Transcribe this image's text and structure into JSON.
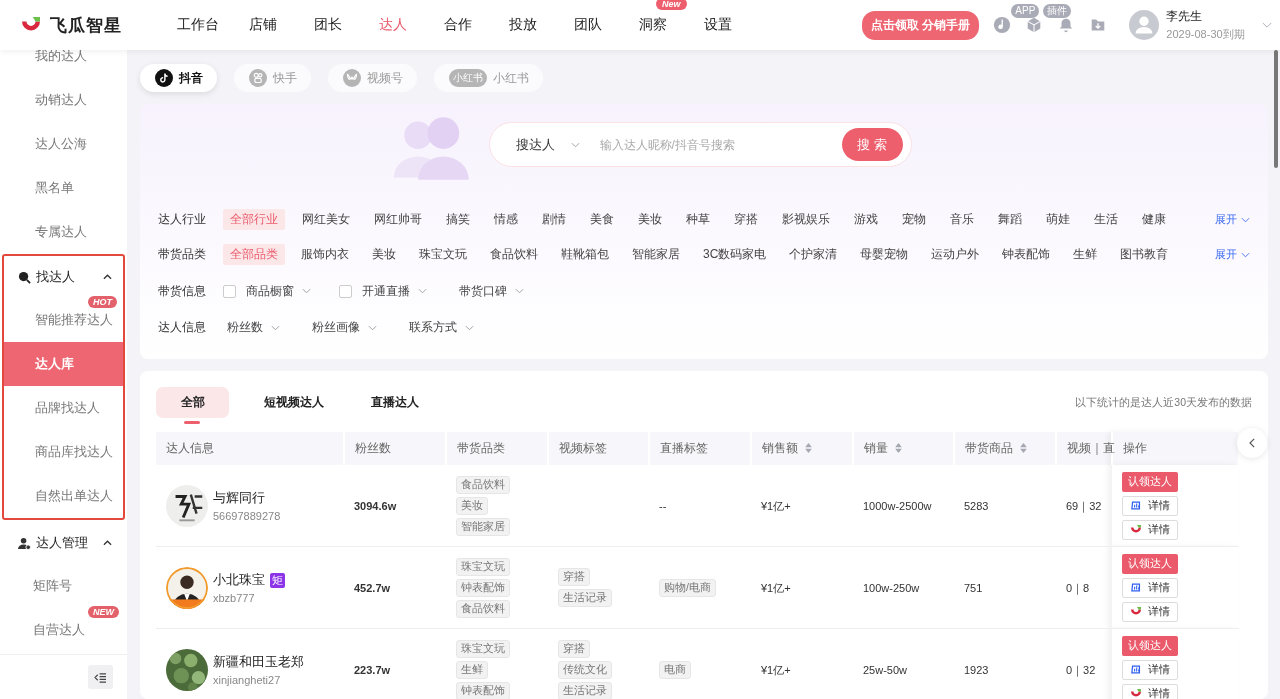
{
  "brand": {
    "name": "飞瓜智星"
  },
  "nav": [
    {
      "label": "工作台",
      "selected": false
    },
    {
      "label": "店铺",
      "selected": false
    },
    {
      "label": "团长",
      "selected": false
    },
    {
      "label": "达人",
      "selected": true
    },
    {
      "label": "合作",
      "selected": false
    },
    {
      "label": "投放",
      "selected": false
    },
    {
      "label": "团队",
      "selected": false
    },
    {
      "label": "洞察",
      "selected": false,
      "badge": "New"
    },
    {
      "label": "设置",
      "selected": false
    }
  ],
  "promo_button": "点击领取 分销手册",
  "header_badges": {
    "app": "APP",
    "plugin": "插件"
  },
  "user": {
    "name": "李先生",
    "expiry": "2029-08-30到期"
  },
  "sidebar": {
    "items": [
      {
        "label": "我的达人"
      },
      {
        "label": "动销达人"
      },
      {
        "label": "达人公海"
      },
      {
        "label": "黑名单"
      },
      {
        "label": "专属达人"
      }
    ],
    "groups": [
      {
        "label": "找达人",
        "expanded": true,
        "outlined": true,
        "children": [
          {
            "label": "智能推荐达人",
            "selected": false,
            "badge": "HOT"
          },
          {
            "label": "达人库",
            "selected": true
          },
          {
            "label": "品牌找达人",
            "selected": false
          },
          {
            "label": "商品库找达人",
            "selected": false
          },
          {
            "label": "自然出单达人",
            "selected": false
          }
        ]
      },
      {
        "label": "达人管理",
        "expanded": true,
        "outlined": false,
        "children": [
          {
            "label": "矩阵号",
            "selected": false
          },
          {
            "label": "自营达人",
            "selected": false,
            "badge": "NEW"
          }
        ]
      }
    ]
  },
  "platforms": [
    {
      "label": "抖音",
      "kind": "douyin",
      "selected": true
    },
    {
      "label": "快手",
      "kind": "kuaishou",
      "selected": false
    },
    {
      "label": "视频号",
      "kind": "shipinhao",
      "selected": false
    },
    {
      "label": "小红书",
      "kind": "xiaohongshu",
      "selected": false,
      "icon_text": "小红书"
    }
  ],
  "search": {
    "scope": "搜达人",
    "placeholder": "输入达人昵称/抖音号搜索",
    "button": "搜 索"
  },
  "filters": [
    {
      "label": "达人行业",
      "kind": "options",
      "expand": "展开",
      "options": [
        {
          "label": "全部行业",
          "selected": true
        },
        {
          "label": "网红美女",
          "selected": false
        },
        {
          "label": "网红帅哥",
          "selected": false
        },
        {
          "label": "搞笑",
          "selected": false
        },
        {
          "label": "情感",
          "selected": false
        },
        {
          "label": "剧情",
          "selected": false
        },
        {
          "label": "美食",
          "selected": false
        },
        {
          "label": "美妆",
          "selected": false
        },
        {
          "label": "种草",
          "selected": false
        },
        {
          "label": "穿搭",
          "selected": false
        },
        {
          "label": "影视娱乐",
          "selected": false
        },
        {
          "label": "游戏",
          "selected": false
        },
        {
          "label": "宠物",
          "selected": false
        },
        {
          "label": "音乐",
          "selected": false
        },
        {
          "label": "舞蹈",
          "selected": false
        },
        {
          "label": "萌娃",
          "selected": false
        },
        {
          "label": "生活",
          "selected": false
        },
        {
          "label": "健康",
          "selected": false
        }
      ]
    },
    {
      "label": "带货品类",
      "kind": "options",
      "expand": "展开",
      "options": [
        {
          "label": "全部品类",
          "selected": true
        },
        {
          "label": "服饰内衣",
          "selected": false
        },
        {
          "label": "美妆",
          "selected": false
        },
        {
          "label": "珠宝文玩",
          "selected": false
        },
        {
          "label": "食品饮料",
          "selected": false
        },
        {
          "label": "鞋靴箱包",
          "selected": false
        },
        {
          "label": "智能家居",
          "selected": false
        },
        {
          "label": "3C数码家电",
          "selected": false
        },
        {
          "label": "个护家清",
          "selected": false
        },
        {
          "label": "母婴宠物",
          "selected": false
        },
        {
          "label": "运动户外",
          "selected": false
        },
        {
          "label": "钟表配饰",
          "selected": false
        },
        {
          "label": "生鲜",
          "selected": false
        },
        {
          "label": "图书教育",
          "selected": false
        }
      ]
    },
    {
      "label": "带货信息",
      "kind": "dropdowns",
      "items": [
        {
          "label": "商品橱窗",
          "kind": "checkbox",
          "checked": false
        },
        {
          "label": "开通直播",
          "kind": "checkbox",
          "checked": false
        },
        {
          "label": "带货口碑",
          "kind": "dropdown"
        }
      ]
    },
    {
      "label": "达人信息",
      "kind": "dropdowns",
      "items": [
        {
          "label": "粉丝数",
          "kind": "dropdown"
        },
        {
          "label": "粉丝画像",
          "kind": "dropdown"
        },
        {
          "label": "联系方式",
          "kind": "dropdown"
        }
      ]
    }
  ],
  "result_tabs": [
    {
      "label": "全部",
      "selected": true
    },
    {
      "label": "短视频达人",
      "selected": false
    },
    {
      "label": "直播达人",
      "selected": false
    }
  ],
  "note": "以下统计的是达人近30天发布的数据",
  "table": {
    "columns": [
      {
        "label": "达人信息",
        "sortable": false
      },
      {
        "label": "粉丝数",
        "sortable": false
      },
      {
        "label": "带货品类",
        "sortable": false
      },
      {
        "label": "视频标签",
        "sortable": false
      },
      {
        "label": "直播标签",
        "sortable": false
      },
      {
        "label": "销售额",
        "sortable": true
      },
      {
        "label": "销量",
        "sortable": true
      },
      {
        "label": "带货商品",
        "sortable": true
      },
      {
        "label": "视频｜直"
      },
      {
        "label": "操作",
        "sortable": false
      }
    ],
    "rows": [
      {
        "name": "与辉同行",
        "account": "56697889278",
        "fans": "3094.6w",
        "categories": [
          "食品饮料",
          "美妆",
          "智能家居"
        ],
        "video_tags": [],
        "live_tags": [],
        "live_empty": "--",
        "sales": "¥1亿+",
        "volume": "1000w-2500w",
        "products": "5283",
        "video_live": "69｜32",
        "actions": [
          {
            "kind": "claim",
            "label": "认领达人"
          },
          {
            "kind": "detail_chart",
            "label": "详情"
          },
          {
            "kind": "detail_brand",
            "label": "详情"
          }
        ]
      },
      {
        "name": "小北珠宝",
        "badge": "矩",
        "account": "xbzb777",
        "fans": "452.7w",
        "categories": [
          "珠宝文玩",
          "钟表配饰",
          "食品饮料"
        ],
        "video_tags": [
          "穿搭",
          "生活记录"
        ],
        "live_tags": [
          "购物/电商"
        ],
        "sales": "¥1亿+",
        "volume": "100w-250w",
        "products": "751",
        "video_live": "0｜8",
        "actions": [
          {
            "kind": "claim",
            "label": "认领达人"
          },
          {
            "kind": "detail_chart",
            "label": "详情"
          },
          {
            "kind": "detail_brand",
            "label": "详情"
          }
        ]
      },
      {
        "name": "新疆和田玉老郑",
        "account": "xinjiangheti27",
        "fans": "223.7w",
        "categories": [
          "珠宝文玩",
          "生鲜",
          "钟表配饰"
        ],
        "video_tags": [
          "穿搭",
          "传统文化",
          "生活记录"
        ],
        "live_tags": [
          "电商"
        ],
        "sales": "¥1亿+",
        "volume": "25w-50w",
        "products": "1923",
        "video_live": "0｜32",
        "actions": [
          {
            "kind": "claim",
            "label": "认领达人"
          },
          {
            "kind": "detail_chart",
            "label": "详情"
          },
          {
            "kind": "detail_brand",
            "label": "详情"
          }
        ]
      }
    ]
  }
}
